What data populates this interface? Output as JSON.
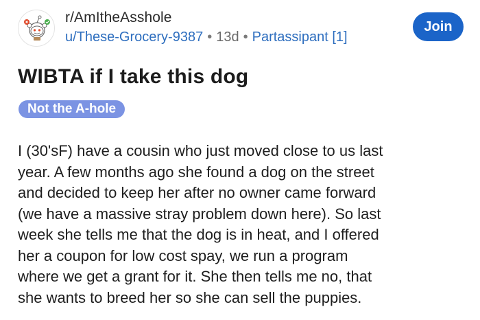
{
  "header": {
    "subreddit": "r/AmItheAsshole",
    "username": "u/These-Grocery-9387",
    "separator": "•",
    "age": "13d",
    "user_flair": "Partassipant [1]",
    "join_label": "Join"
  },
  "post": {
    "title": "WIBTA if I take this dog",
    "flair": "Not the A-hole",
    "body_lines": [
      "I (30'sF) have a cousin who just moved close to us last",
      "year. A few months ago she found a dog on the street",
      "and decided to keep her after no owner came forward",
      "(we have a massive stray problem down here). So last",
      "week she tells me that the dog is in heat, and I offered",
      "her a coupon for low cost spay, we run a program",
      "where we get a grant for it. She then tells me no, that",
      "she wants to breed her so she can sell the puppies."
    ]
  },
  "colors": {
    "join_bg": "#1b64c8",
    "link_blue": "#2f6fbf",
    "flair_bg": "#7b93e3"
  },
  "icons": {
    "avatar": "subreddit-avatar-icon"
  }
}
